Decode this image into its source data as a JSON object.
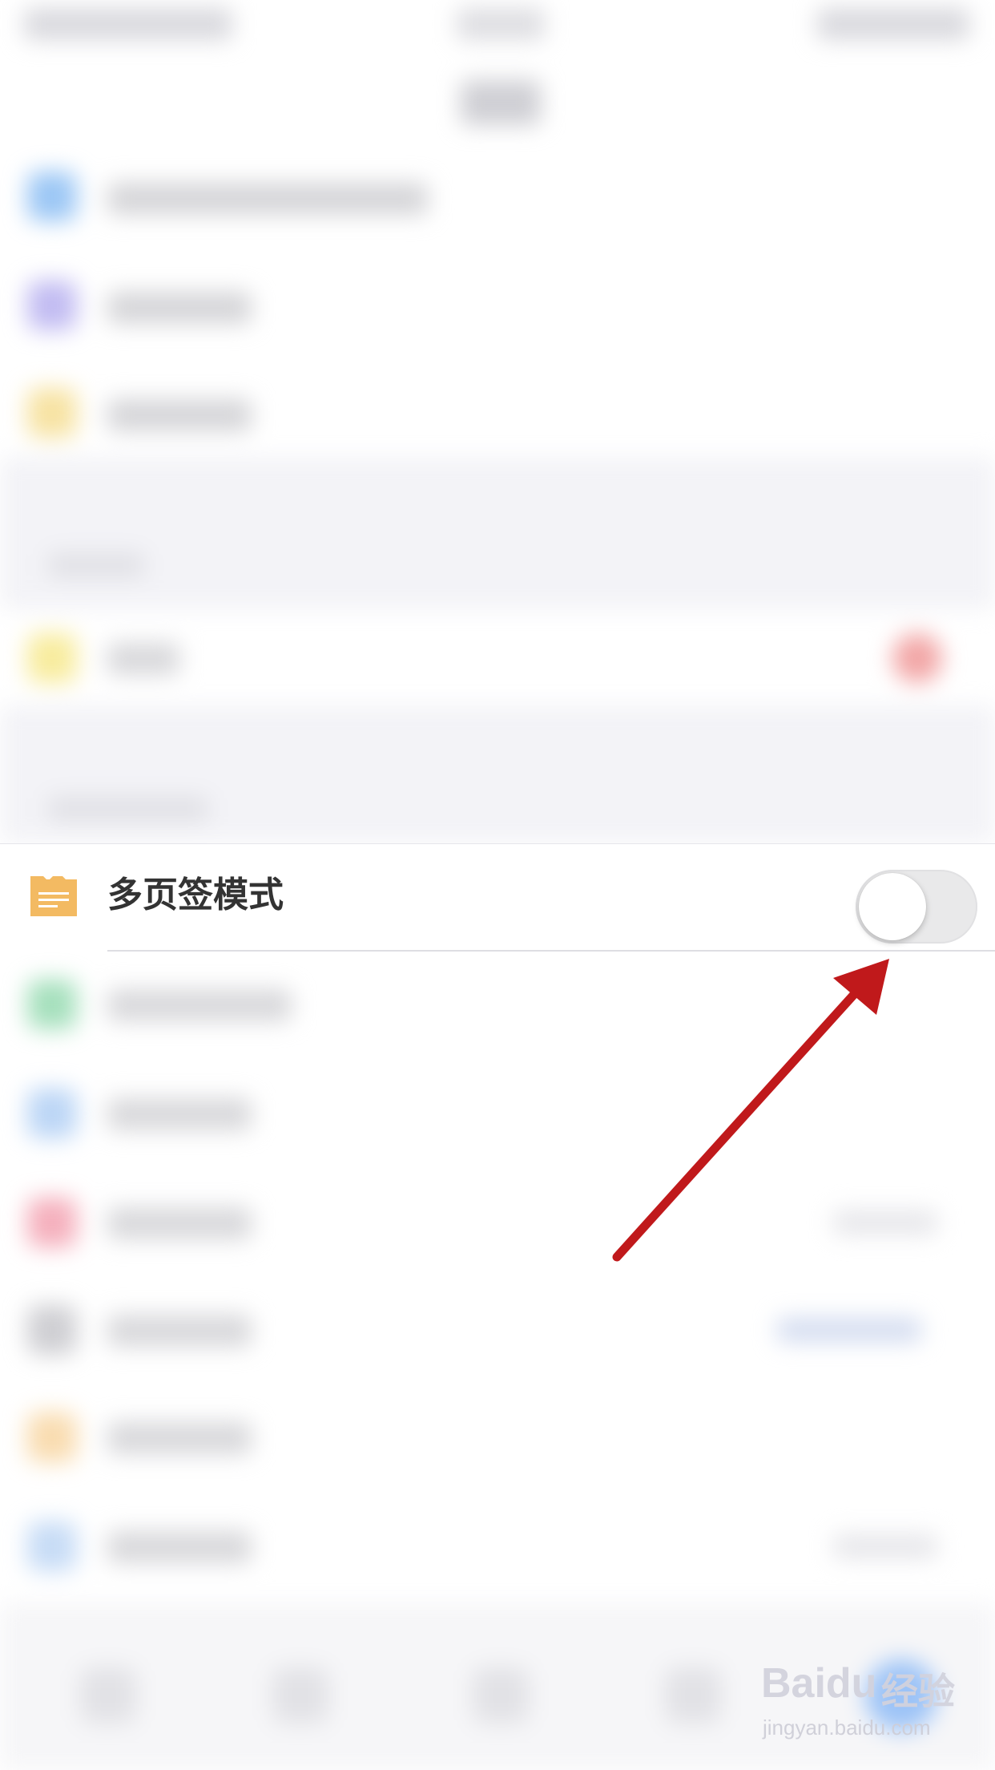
{
  "setting_row": {
    "label": "多页签模式",
    "icon": "folder-list-icon",
    "icon_color": "#F3BA62",
    "toggle": {
      "on": false
    }
  },
  "annotation": {
    "arrow_color": "#C0191B"
  },
  "watermark": {
    "brand": "Baidu",
    "cn": "经验",
    "url": "jingyan.baidu.com"
  }
}
